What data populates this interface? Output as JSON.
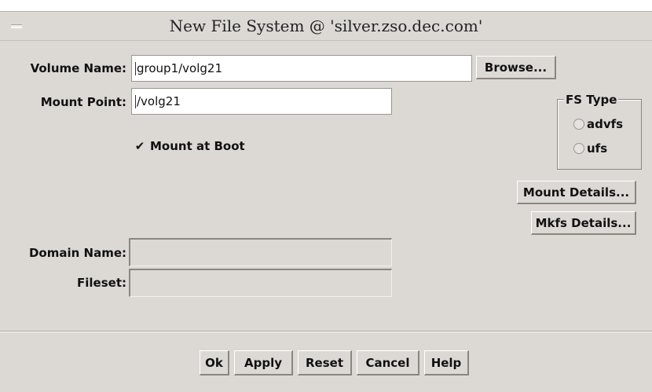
{
  "window": {
    "title": "New File System @ 'silver.zso.dec.com'"
  },
  "form": {
    "volume_name_label": "Volume Name:",
    "volume_name_value": "group1/volg21",
    "browse_label": "Browse...",
    "mount_point_label": "Mount Point:",
    "mount_point_value": "/volg21",
    "mount_at_boot_label": "Mount at Boot",
    "mount_at_boot_checked": true,
    "domain_name_label": "Domain Name:",
    "domain_name_value": "",
    "fileset_label": "Fileset:",
    "fileset_value": ""
  },
  "fs_type": {
    "legend": "FS Type",
    "options": [
      "advfs",
      "ufs"
    ],
    "selected": null
  },
  "side_buttons": {
    "mount_details": "Mount Details...",
    "mkfs_details": "Mkfs Details..."
  },
  "footer": {
    "ok": "Ok",
    "apply": "Apply",
    "reset": "Reset",
    "cancel": "Cancel",
    "help": "Help"
  },
  "icons": {
    "window_menu": "window-menu-icon",
    "checkmark": "checkmark-icon",
    "radio": "radio-icon"
  },
  "colors": {
    "background": "#dcd9d5",
    "field": "#ffffff",
    "text": "#111111"
  }
}
